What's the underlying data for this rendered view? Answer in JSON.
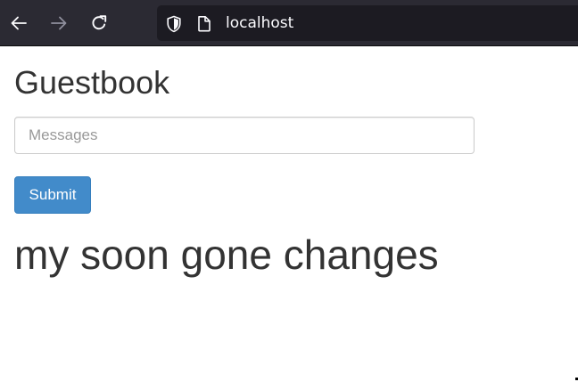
{
  "browser": {
    "url": "localhost",
    "icons": {
      "back": "arrow-left-icon",
      "forward": "arrow-right-icon",
      "reload": "reload-icon",
      "tracking": "shield-icon",
      "page": "page-icon"
    },
    "colors": {
      "toolbar": "#2b2a33",
      "url_bar": "#1c1b22"
    }
  },
  "guestbook": {
    "title": "Guestbook",
    "message_placeholder": "Messages",
    "message_value": "",
    "submit_label": "Submit",
    "entries": [
      "my soon gone changes"
    ]
  },
  "colors": {
    "primary_button": "#428bca",
    "text": "#333333"
  }
}
